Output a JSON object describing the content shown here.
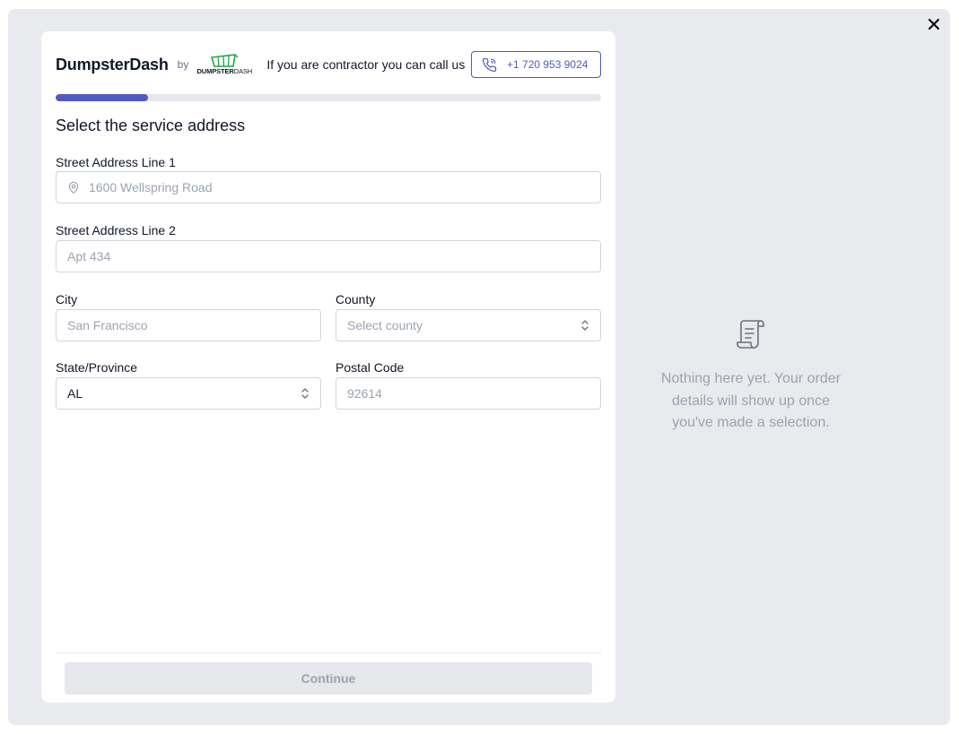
{
  "brand": {
    "name": "DumpsterDash",
    "by": "by",
    "logo_text_bold": "DUMPSTER",
    "logo_text_light": "DASH",
    "logo_color": "#22a845"
  },
  "header": {
    "contractor_text": "If you are contractor you can call us",
    "phone": "+1 720 953 9024"
  },
  "progress": {
    "value_fraction": 0.17,
    "color": "#4f5bbf"
  },
  "form": {
    "title": "Select the service address",
    "street1": {
      "label": "Street Address Line 1",
      "placeholder": "1600 Wellspring Road",
      "icon": "map-pin-icon"
    },
    "street2": {
      "label": "Street Address Line 2",
      "placeholder": "Apt 434"
    },
    "city": {
      "label": "City",
      "placeholder": "San Francisco"
    },
    "county": {
      "label": "County",
      "placeholder": "Select county"
    },
    "state": {
      "label": "State/Province",
      "value": "AL"
    },
    "postal": {
      "label": "Postal Code",
      "placeholder": "92614"
    }
  },
  "continue_label": "Continue",
  "summary": {
    "empty_text": "Nothing here yet. Your order details will show up once you've made a selection.",
    "icon": "receipt-scroll-icon"
  },
  "colors": {
    "accent": "#4f5bbf",
    "muted": "#9ca3af",
    "backdrop": "#e8eaed"
  }
}
